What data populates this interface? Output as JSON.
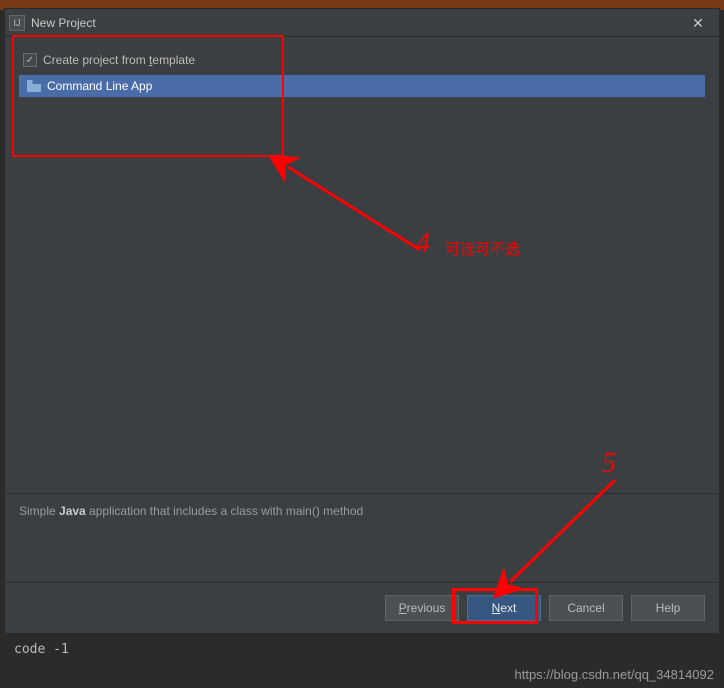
{
  "titlebar": {
    "title": "New Project"
  },
  "checkbox": {
    "label_pre": "Create project from ",
    "label_underlined": "t",
    "label_post": "emplate"
  },
  "template_list": {
    "items": [
      {
        "label": "Command Line App"
      }
    ]
  },
  "description": {
    "pre": "Simple ",
    "bold": "Java",
    "post": " application that includes a class with main() method"
  },
  "buttons": {
    "previous_u": "P",
    "previous_rest": "revious",
    "next_u": "N",
    "next_rest": "ext",
    "cancel": "Cancel",
    "help": "Help"
  },
  "annotations": {
    "num4": "4",
    "text4": "可选可不选",
    "num5": "5"
  },
  "console": {
    "text": "code -1"
  },
  "watermark": "https://blog.csdn.net/qq_34814092"
}
